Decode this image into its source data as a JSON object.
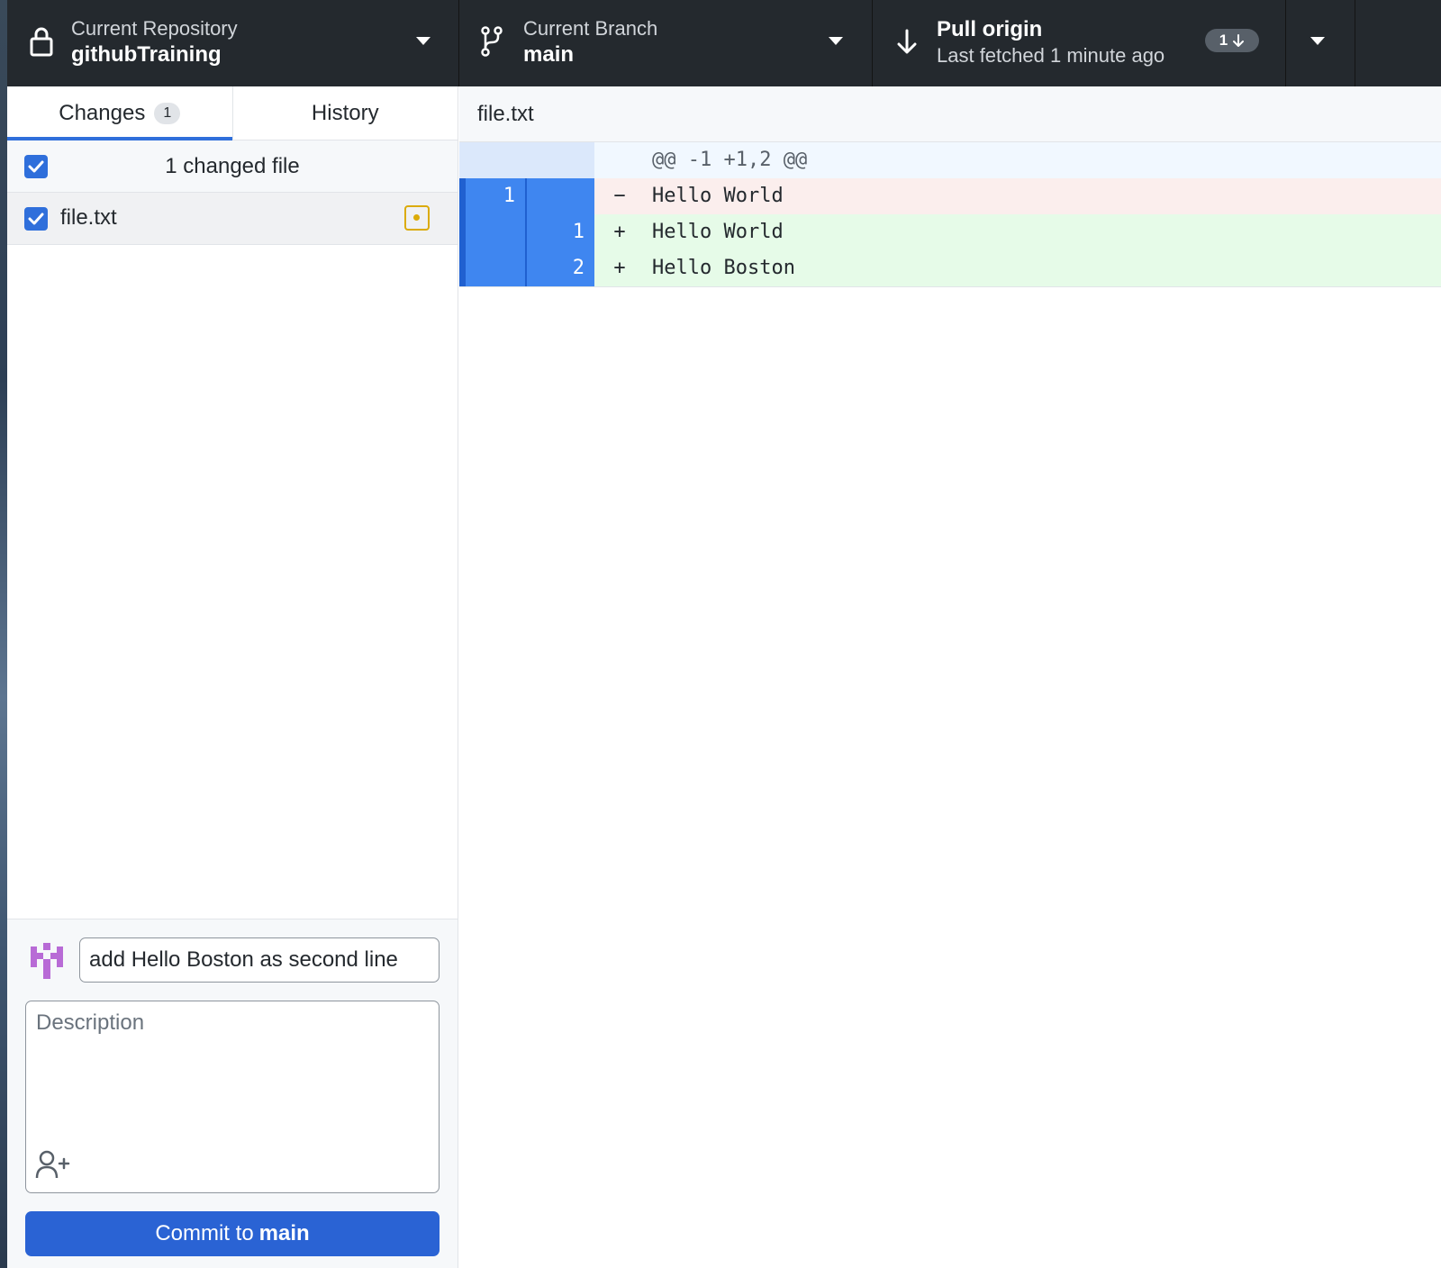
{
  "toolbar": {
    "repo": {
      "label": "Current Repository",
      "title": "githubTraining",
      "icon": "lock-icon"
    },
    "branch": {
      "label": "Current Branch",
      "title": "main",
      "icon": "git-branch-icon"
    },
    "pull": {
      "title": "Pull origin",
      "subtitle": "Last fetched 1 minute ago",
      "badge_count": "1",
      "icon": "arrow-down-icon"
    }
  },
  "sidebar": {
    "tabs": [
      {
        "label": "Changes",
        "count": "1",
        "active": true
      },
      {
        "label": "History",
        "active": false
      }
    ],
    "changed_files_label": "1 changed file",
    "files": [
      {
        "name": "file.txt",
        "status": "modified",
        "checked": true
      }
    ],
    "commit": {
      "summary_value": "add Hello Boston as second line",
      "description_placeholder": "Description",
      "button_prefix": "Commit to",
      "button_branch": "main"
    }
  },
  "diff": {
    "file_name": "file.txt",
    "hunk_header": "@@ -1 +1,2 @@",
    "lines": [
      {
        "type": "del",
        "old": "1",
        "new": "",
        "sign": "−",
        "text": "Hello World"
      },
      {
        "type": "add",
        "old": "",
        "new": "1",
        "sign": "+",
        "text": "Hello World"
      },
      {
        "type": "add",
        "old": "",
        "new": "2",
        "sign": "+",
        "text": "Hello Boston"
      }
    ]
  },
  "colors": {
    "toolbar_bg": "#24292e",
    "accent": "#2f6fdb",
    "modified": "#dbab09",
    "deletion_bg": "#fbeeed",
    "addition_bg": "#e6fbe8"
  }
}
